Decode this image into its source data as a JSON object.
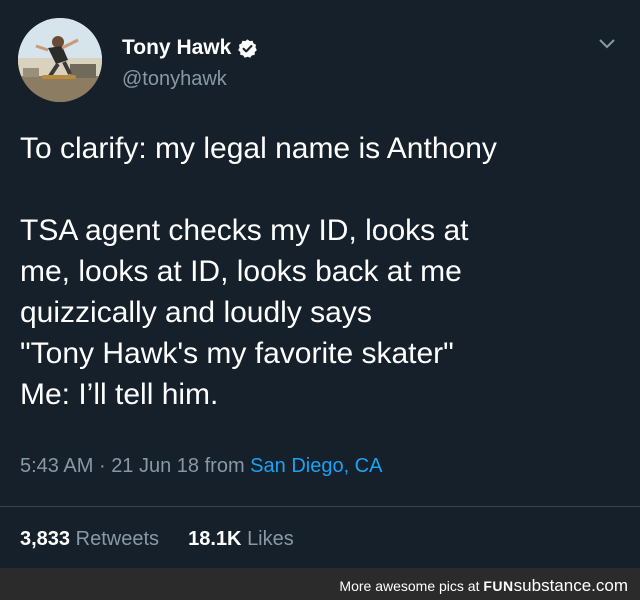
{
  "author": {
    "display_name": "Tony Hawk",
    "handle": "@tonyhawk",
    "verified": true,
    "avatar_icon": "skater-photo-avatar"
  },
  "tweet": {
    "lines": [
      "To clarify: my legal name is Anthony",
      "TSA agent checks my ID, looks at",
      "me, looks at ID, looks back at me",
      "quizzically and loudly says",
      "\"Tony Hawk's my favorite skater\"",
      "Me: I’ll tell him."
    ],
    "time": "5:43 AM",
    "separator": "·",
    "date": "21 Jun 18",
    "from_label": "from",
    "location": "San Diego, CA"
  },
  "stats": {
    "retweets_count": "3,833",
    "retweets_label": "Retweets",
    "likes_count": "18.1K",
    "likes_label": "Likes"
  },
  "footer": {
    "text": "More awesome pics at",
    "brand_fun": "FUN",
    "brand_substance": "substance",
    "brand_com": ".com"
  },
  "colors": {
    "background": "#15202b",
    "link": "#1da1f2",
    "secondary_text": "#8899a6",
    "verified_badge": "#ffffff"
  }
}
